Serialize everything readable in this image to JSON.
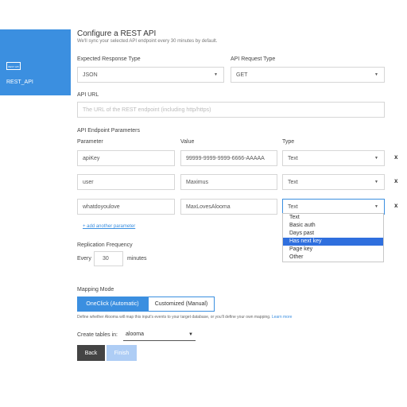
{
  "sidebar": {
    "logo_text": "REST API",
    "label": "REST_API"
  },
  "header": {
    "title": "Configure a REST API",
    "subtitle": "We'll sync your selected API endpoint every 30 minutes by default."
  },
  "response_type": {
    "label": "Expected Response Type",
    "value": "JSON"
  },
  "request_type": {
    "label": "API Request Type",
    "value": "GET"
  },
  "api_url": {
    "label": "API URL",
    "placeholder": "The URL of the REST endpoint (including http/https)"
  },
  "params": {
    "section_label": "API Endpoint Parameters",
    "col_parameter": "Parameter",
    "col_value": "Value",
    "col_type": "Type",
    "rows": [
      {
        "parameter": "apiKey",
        "value": "99999-9999-9999-6666-AAAAA",
        "type": "Text"
      },
      {
        "parameter": "user",
        "value": "Maximus",
        "type": "Text"
      },
      {
        "parameter": "whatdoyoulove",
        "value": "MaxLovesAlooma",
        "type": "Text"
      }
    ],
    "remove_label": "x",
    "add_link": "+ add another parameter"
  },
  "type_dropdown": {
    "options": [
      "Text",
      "Basic auth",
      "Days past",
      "Has next key",
      "Page key",
      "Other"
    ],
    "highlighted": "Has next key"
  },
  "replication": {
    "label": "Replication Frequency",
    "prefix": "Every",
    "value": "30",
    "suffix": "minutes"
  },
  "mapping": {
    "label": "Mapping Mode",
    "option_auto": "OneClick (Automatic)",
    "option_manual": "Customized (Manual)",
    "note": "Define whether Alooma will map this input's events to your target database, or you'll define your own mapping.",
    "learn_more": "Learn more"
  },
  "tables": {
    "label": "Create tables in:",
    "value": "alooma"
  },
  "buttons": {
    "back": "Back",
    "finish": "Finish"
  },
  "colors": {
    "accent": "#3b8fe0",
    "highlight": "#2f6fde",
    "back_button": "#444444",
    "finish_disabled": "#aecdf5"
  }
}
